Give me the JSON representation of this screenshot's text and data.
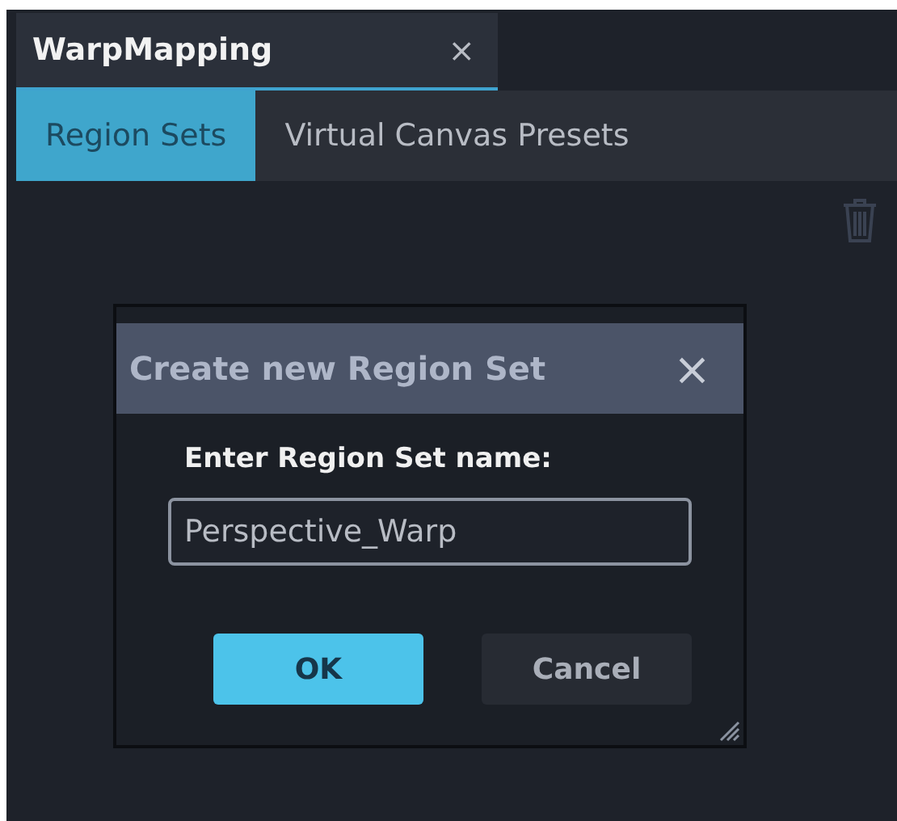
{
  "panel": {
    "title": "WarpMapping",
    "close": "×"
  },
  "tabs": [
    {
      "label": "Region Sets",
      "selected": true
    },
    {
      "label": "Virtual Canvas Presets",
      "selected": false
    }
  ],
  "dialog": {
    "title": "Create new Region Set",
    "close": "×",
    "prompt": "Enter Region Set name:",
    "value": "Perspective_Warp",
    "buttons": [
      {
        "label": "OK",
        "kind": "primary"
      },
      {
        "label": "Cancel",
        "kind": "secondary"
      }
    ]
  }
}
